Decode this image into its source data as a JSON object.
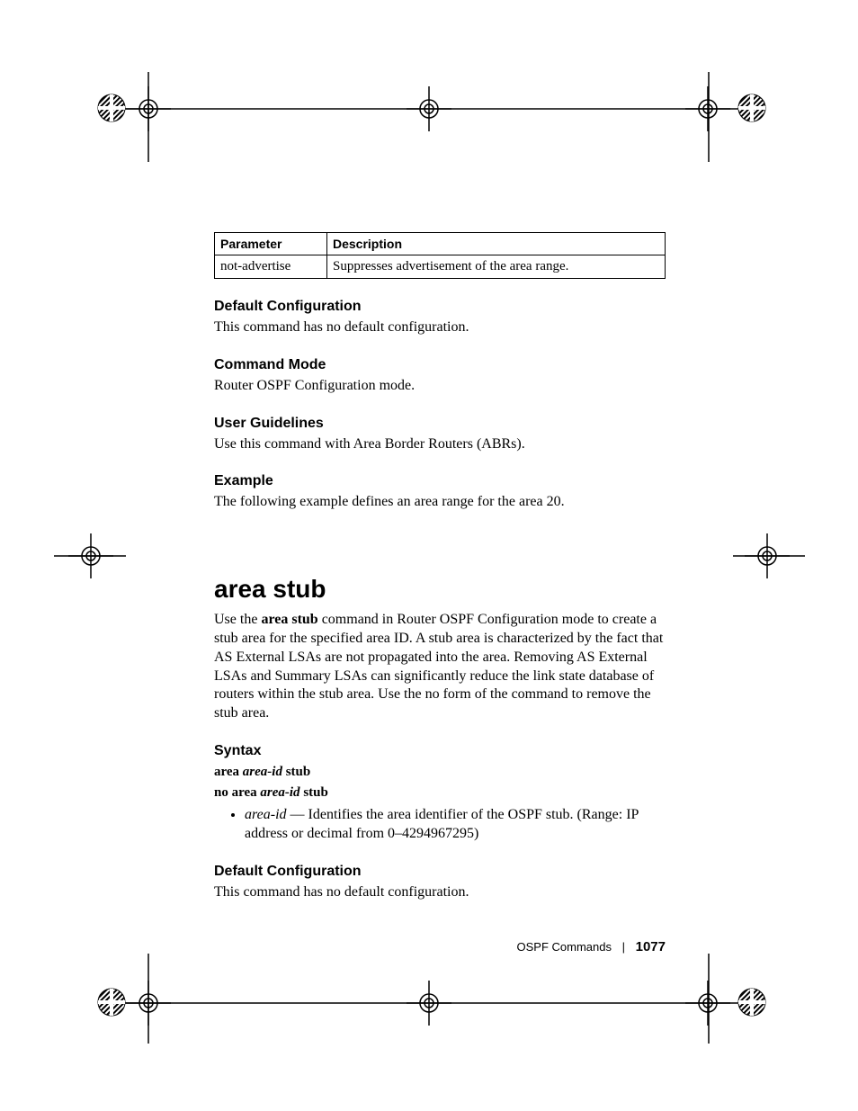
{
  "table": {
    "headers": {
      "parameter": "Parameter",
      "description": "Description"
    },
    "rows": [
      {
        "parameter": "not-advertise",
        "description": "Suppresses advertisement of the area range."
      }
    ]
  },
  "sections": {
    "default_config1": {
      "heading": "Default Configuration",
      "body": "This command has no default configuration."
    },
    "command_mode": {
      "heading": "Command Mode",
      "body": "Router OSPF Configuration mode."
    },
    "user_guidelines": {
      "heading": "User Guidelines",
      "body": "Use this command with Area Border Routers (ABRs)."
    },
    "example": {
      "heading": "Example",
      "body": "The following example defines an area range for the area 20."
    }
  },
  "command": {
    "title": "area stub",
    "intro_pre": "Use the ",
    "intro_bold": "area stub",
    "intro_post": " command in Router OSPF Configuration mode to create a stub area for the specified area ID. A stub area is characterized by the fact that AS External LSAs are not propagated into the area. Removing AS External LSAs and Summary LSAs can significantly reduce the link state database of routers within the stub area. Use the no form of the command to remove the stub area."
  },
  "syntax": {
    "heading": "Syntax",
    "line1": {
      "w1": "area",
      "w2": "area-id",
      "w3": "stub"
    },
    "line2": {
      "w1": "no area",
      "w2": "area-id",
      "w3": "stub"
    },
    "bullet": {
      "term": "area-id",
      "dash": " — ",
      "desc": "Identifies the area identifier of the OSPF stub. (Range: IP address or decimal from 0–4294967295)"
    }
  },
  "sections2": {
    "default_config2": {
      "heading": "Default Configuration",
      "body": "This command has no default configuration."
    }
  },
  "footer": {
    "section": "OSPF Commands",
    "page": "1077"
  }
}
